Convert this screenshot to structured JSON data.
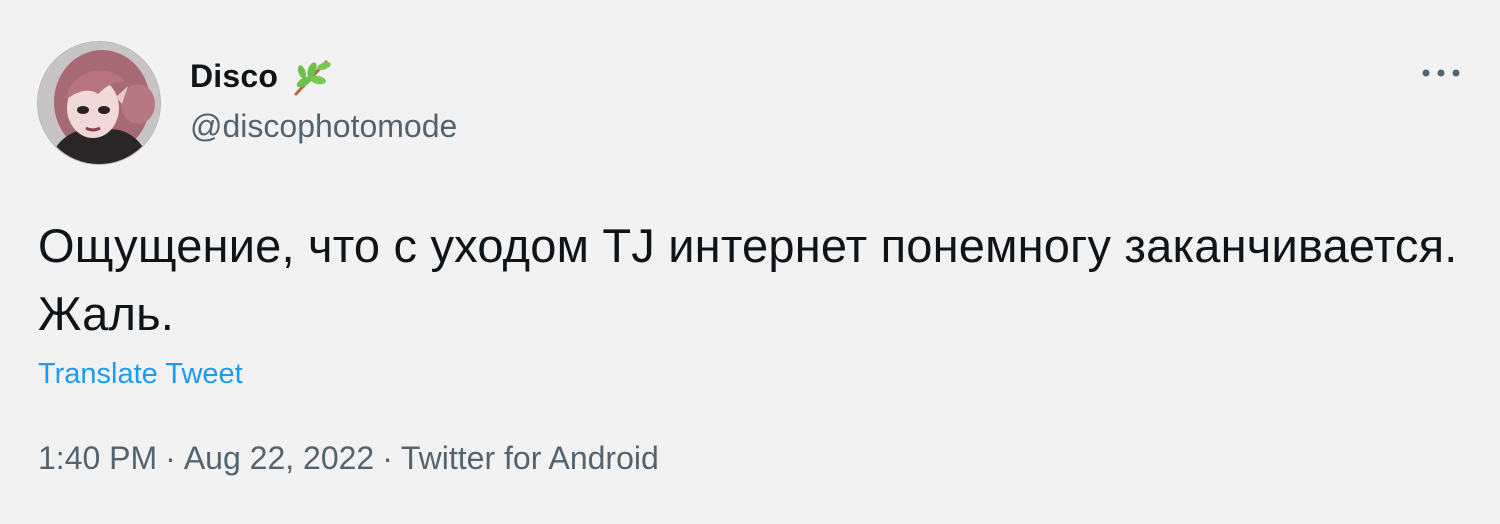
{
  "author": {
    "display_name": "Disco",
    "name_emoji": "herb-icon",
    "username": "@discophotomode",
    "avatar": "avatar-illustration"
  },
  "menu": {
    "more_icon": "more-horizontal-icon"
  },
  "tweet": {
    "text": "Ощущение, что с уходом TJ интернет понемногу заканчивается. Жаль.",
    "translate_label": "Translate Tweet"
  },
  "meta": {
    "time": "1:40 PM",
    "separator": "·",
    "date": "Aug 22, 2022",
    "source": "Twitter for Android"
  },
  "colors": {
    "background": "#f2f2f2",
    "text": "#0f1419",
    "secondary": "#536471",
    "link": "#1d9bf0"
  }
}
